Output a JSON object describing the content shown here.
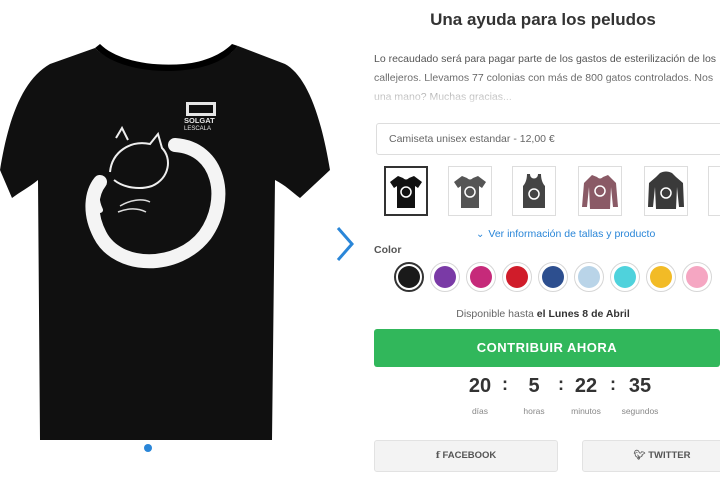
{
  "product": {
    "title": "Una ayuda para los peludos",
    "description_lines": [
      "Lo recaudado será para pagar parte de los gastos de esterilización de los",
      "callejeros. Llevamos 77 colonias con más de 800 gatos controlados. Nos",
      "una mano? Muchas gracias..."
    ],
    "variant_select": "Camiseta unisex estandar - 12,00 €",
    "style_thumbs": [
      "black-tshirt-icon",
      "gray-tshirt-icon",
      "tank-top-icon",
      "long-sleeve-icon",
      "hoodie-icon",
      "partial-shirt-icon"
    ],
    "info_link": "Ver información de tallas y producto",
    "color_label": "Color",
    "colors": [
      "#1a1a1a",
      "#7a3aa6",
      "#c62a7a",
      "#d01c2a",
      "#2d4f8f",
      "#b9d4e8",
      "#4fd2dc",
      "#f2bb26",
      "#f5a6c2"
    ],
    "availability_prefix": "Disponible hasta ",
    "availability_date": "el Lunes 8 de Abril",
    "cta": "CONTRIBUIR AHORA",
    "countdown": {
      "days": "20",
      "days_label": "días",
      "hours": "5",
      "hours_label": "horas",
      "minutes": "22",
      "minutes_label": "minutos",
      "seconds": "35",
      "seconds_label": "segundos"
    },
    "share": {
      "facebook": "FACEBOOK",
      "twitter": "TWITTER"
    },
    "logo_text": [
      "SOLGAT",
      "LESCALA"
    ]
  }
}
